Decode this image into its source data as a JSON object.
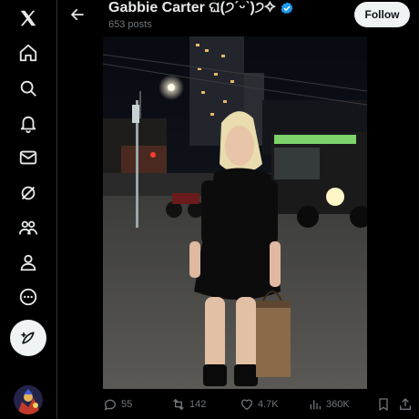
{
  "header": {
    "back_icon": "arrow-left-icon",
    "name": "Gabbie Carter ଘ(੭ˊᵕˋ)੭✧",
    "verified_icon": "verified-badge-icon",
    "posts_count": "653 posts",
    "follow_label": "Follow"
  },
  "sidebar": {
    "items": [
      {
        "icon": "x-logo-icon"
      },
      {
        "icon": "home-icon"
      },
      {
        "icon": "search-icon"
      },
      {
        "icon": "bell-icon"
      },
      {
        "icon": "mail-icon"
      },
      {
        "icon": "grok-icon"
      },
      {
        "icon": "communities-icon"
      },
      {
        "icon": "profile-icon"
      },
      {
        "icon": "more-icon"
      },
      {
        "icon": "post-compose-icon"
      }
    ]
  },
  "actions": {
    "replies": "55",
    "reposts": "142",
    "likes": "4.7K",
    "views": "360K"
  },
  "colors": {
    "background": "#000000",
    "text": "#e7e9ea",
    "muted": "#71767b",
    "verified": "#1d9bf0",
    "button": "#eff3f4"
  }
}
